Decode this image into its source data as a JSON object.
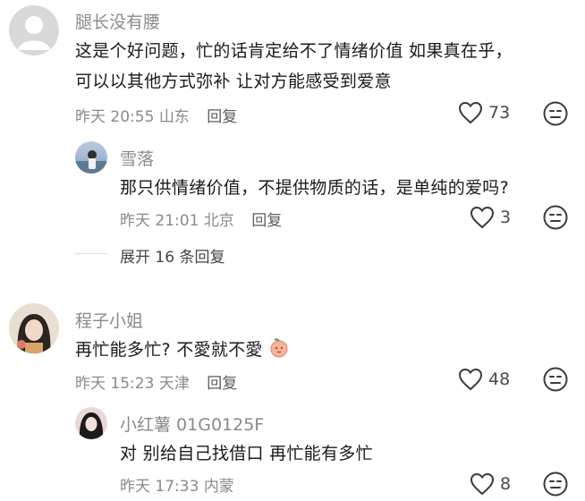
{
  "comments": [
    {
      "author": "腿长没有腰",
      "text_line1": "这是个好问题，忙的话肯定给不了情绪价值 如果真在乎，",
      "text_line2": "可以以其他方式弥补 让对方能感受到爱意",
      "date": "昨天",
      "time": "20:55",
      "location": "山东",
      "reply_label": "回复",
      "likes": "73"
    },
    {
      "author": "雪落",
      "text": "那只供情绪价值，不提供物质的话，是单纯的爱吗?",
      "date": "昨天",
      "time": "21:01",
      "location": "北京",
      "reply_label": "回复",
      "likes": "3"
    },
    {
      "expand_label": "展开 16 条回复"
    },
    {
      "author": "程子小姐",
      "text": "再忙能多忙? 不愛就不愛",
      "date": "昨天",
      "time": "15:23",
      "location": "天津",
      "reply_label": "回复",
      "likes": "48"
    },
    {
      "author": "小红薯 01G0125F",
      "text": "对 别给自己找借口 再忙能有多忙",
      "date": "昨天",
      "time": "17:33",
      "location": "内蒙",
      "reply_label": "",
      "likes": "8"
    }
  ],
  "colors": {
    "meta": "#8a8a8a",
    "text": "#1a1a1a",
    "icon": "#3a3a3a"
  }
}
